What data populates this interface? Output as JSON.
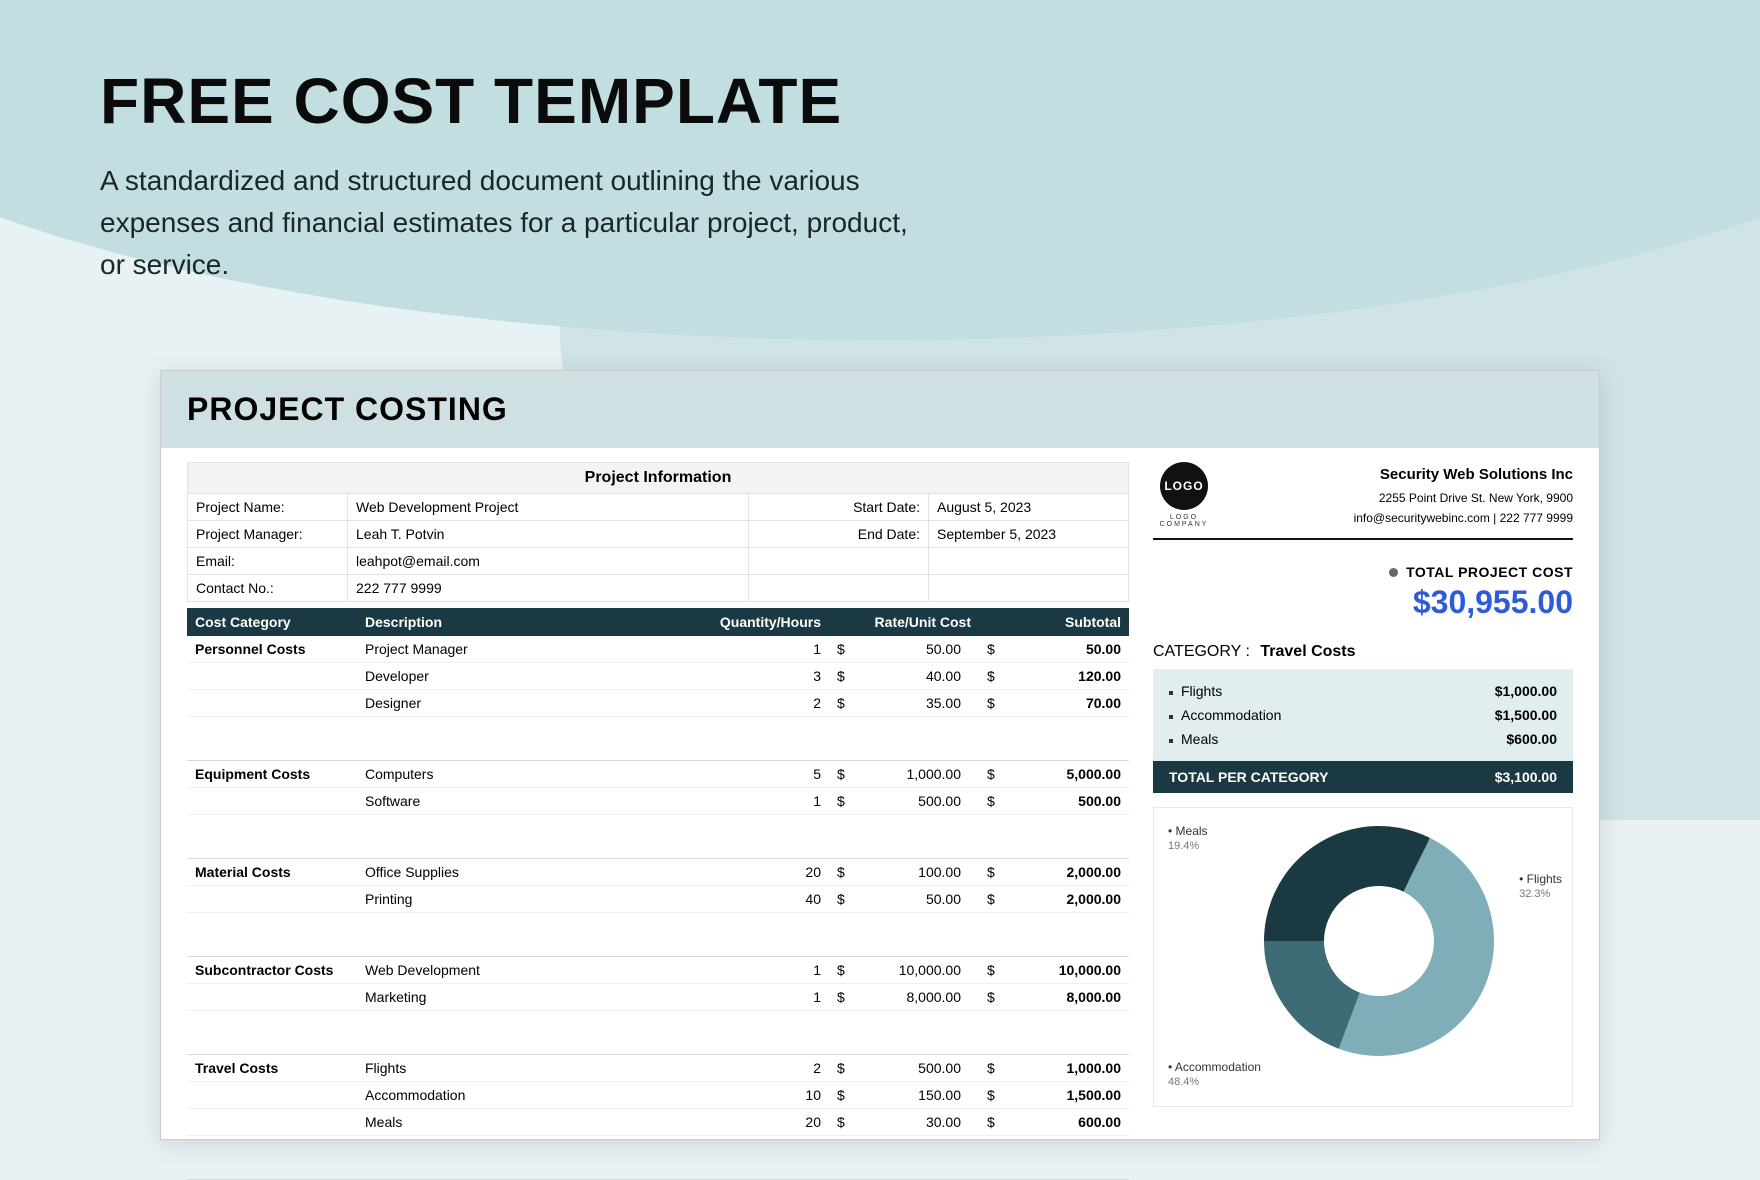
{
  "hero": {
    "title": "FREE COST TEMPLATE",
    "subtitle": "A standardized and structured document outlining the various expenses and financial estimates for a particular project, product, or service."
  },
  "sheet_title": "PROJECT COSTING",
  "project_info": {
    "title": "Project Information",
    "rows": [
      {
        "label": "Project Name:",
        "value": "Web Development Project",
        "label2": "Start Date:",
        "value2": "August 5, 2023"
      },
      {
        "label": "Project Manager:",
        "value": "Leah T. Potvin",
        "label2": "End Date:",
        "value2": "September 5, 2023"
      },
      {
        "label": "Email:",
        "value": "leahpot@email.com",
        "label2": "",
        "value2": ""
      },
      {
        "label": "Contact No.:",
        "value": "222 777 9999",
        "label2": "",
        "value2": ""
      }
    ]
  },
  "cost_headers": {
    "cat": "Cost Category",
    "desc": "Description",
    "qty": "Quantity/Hours",
    "rate": "Rate/Unit Cost",
    "sub": "Subtotal"
  },
  "costs": [
    {
      "cat": "Personnel Costs",
      "items": [
        {
          "desc": "Project Manager",
          "qty": "1",
          "rate": "50.00",
          "sub": "50.00"
        },
        {
          "desc": "Developer",
          "qty": "3",
          "rate": "40.00",
          "sub": "120.00"
        },
        {
          "desc": "Designer",
          "qty": "2",
          "rate": "35.00",
          "sub": "70.00"
        }
      ]
    },
    {
      "cat": "Equipment Costs",
      "items": [
        {
          "desc": "Computers",
          "qty": "5",
          "rate": "1,000.00",
          "sub": "5,000.00"
        },
        {
          "desc": "Software",
          "qty": "1",
          "rate": "500.00",
          "sub": "500.00"
        }
      ]
    },
    {
      "cat": "Material Costs",
      "items": [
        {
          "desc": "Office Supplies",
          "qty": "20",
          "rate": "100.00",
          "sub": "2,000.00"
        },
        {
          "desc": "Printing",
          "qty": "40",
          "rate": "50.00",
          "sub": "2,000.00"
        }
      ]
    },
    {
      "cat": "Subcontractor Costs",
      "items": [
        {
          "desc": "Web Development",
          "qty": "1",
          "rate": "10,000.00",
          "sub": "10,000.00"
        },
        {
          "desc": "Marketing",
          "qty": "1",
          "rate": "8,000.00",
          "sub": "8,000.00"
        }
      ]
    },
    {
      "cat": "Travel Costs",
      "items": [
        {
          "desc": "Flights",
          "qty": "2",
          "rate": "500.00",
          "sub": "1,000.00"
        },
        {
          "desc": "Accommodation",
          "qty": "10",
          "rate": "150.00",
          "sub": "1,500.00"
        },
        {
          "desc": "Meals",
          "qty": "20",
          "rate": "30.00",
          "sub": "600.00"
        }
      ]
    }
  ],
  "company": {
    "logo_text": "LOGO",
    "logo_sub": "LOGO COMPANY",
    "name": "Security Web Solutions Inc",
    "addr": "2255  Point Drive St. New York, 9900",
    "contact": "info@securitywebinc.com  |  222 777 9999"
  },
  "total_project": {
    "label": "TOTAL PROJECT COST",
    "value": "$30,955.00"
  },
  "category_focus": {
    "label": "CATEGORY :",
    "name": "Travel Costs",
    "items": [
      {
        "name": "Flights",
        "value": "$1,000.00"
      },
      {
        "name": "Accommodation",
        "value": "$1,500.00"
      },
      {
        "name": "Meals",
        "value": "$600.00"
      }
    ],
    "total_label": "TOTAL PER CATEGORY",
    "total_value": "$3,100.00"
  },
  "chart_data": {
    "type": "pie",
    "title": "",
    "series": [
      {
        "name": "Flights",
        "value": 32.3,
        "color": "#1b3942"
      },
      {
        "name": "Accommodation",
        "value": 48.4,
        "color": "#7fadb8"
      },
      {
        "name": "Meals",
        "value": 19.4,
        "color": "#3d6b76"
      }
    ],
    "labels": {
      "meals": {
        "name": "Meals",
        "pct": "19.4%"
      },
      "flights": {
        "name": "Flights",
        "pct": "32.3%"
      },
      "accom": {
        "name": "Accommodation",
        "pct": "48.4%"
      }
    }
  },
  "dollar": "$"
}
